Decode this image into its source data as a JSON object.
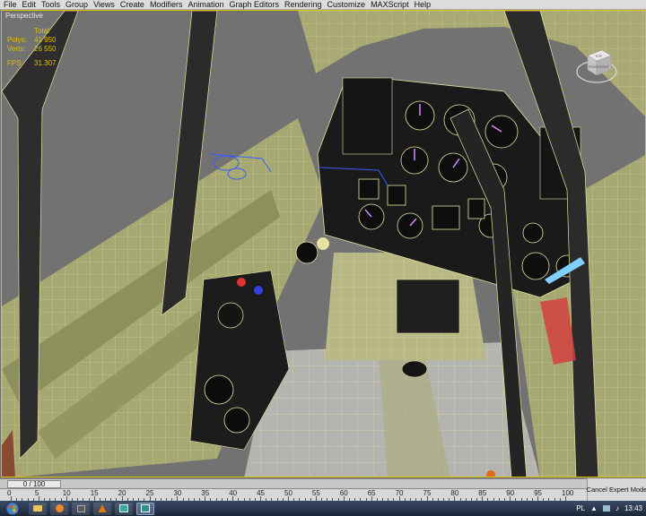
{
  "menubar": {
    "items": [
      "File",
      "Edit",
      "Tools",
      "Group",
      "Views",
      "Create",
      "Modifiers",
      "Animation",
      "Graph Editors",
      "Rendering",
      "Customize",
      "MAXScript",
      "Help"
    ]
  },
  "viewport": {
    "label": "Perspective",
    "stats": {
      "header": "Total",
      "rows": [
        {
          "key": "Polys:",
          "value": "41 950"
        },
        {
          "key": "Verts:",
          "value": "26 550"
        },
        {
          "key": "FPS:",
          "value": "31.307"
        }
      ]
    },
    "viewcube": {
      "top": "TOP",
      "front": "FRONT",
      "right": "RIGHT"
    }
  },
  "timeline": {
    "slider_label": "0 / 100",
    "frame_current": 0,
    "frame_max": 100,
    "ticks": [
      "0",
      "5",
      "10",
      "15",
      "20",
      "25",
      "30",
      "35",
      "40",
      "45",
      "50",
      "55",
      "60",
      "65",
      "70",
      "75",
      "80",
      "85",
      "90",
      "95",
      "100"
    ]
  },
  "expert_mode": {
    "label": "Cancel Expert Mode"
  },
  "taskbar": {
    "language": "PL",
    "clock": "13:43"
  },
  "colors": {
    "wire": "#e6e2a0",
    "hull": "#a9aa73",
    "accent": "#e0c000"
  }
}
